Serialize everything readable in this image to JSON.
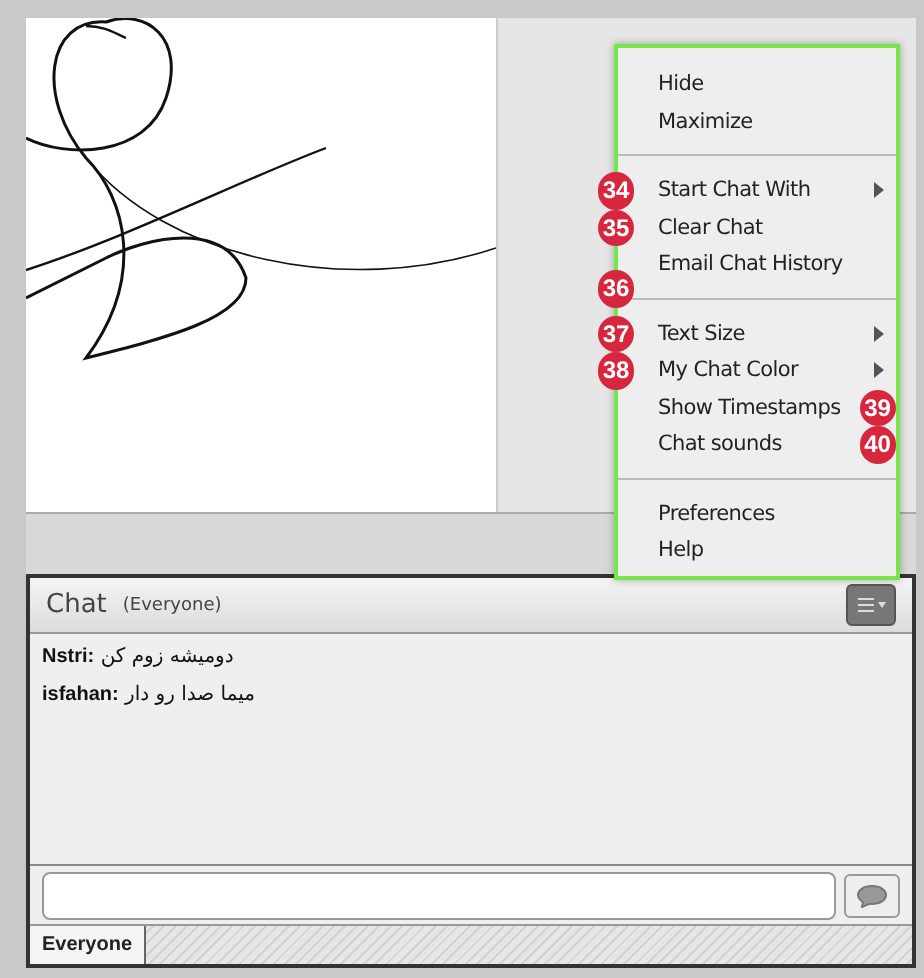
{
  "menu": {
    "sections": [
      {
        "items": [
          {
            "kind": "plain",
            "label": "Hide",
            "submenu": false
          },
          {
            "kind": "plain",
            "label": "Maximize",
            "submenu": false
          }
        ]
      },
      {
        "items": [
          {
            "kind": "badge-left",
            "label": "Start Chat With",
            "submenu": true,
            "badge": "34"
          },
          {
            "kind": "badge-left",
            "label": "Clear Chat",
            "submenu": false,
            "badge": "35"
          },
          {
            "kind": "badge-below",
            "label": "Email Chat History",
            "submenu": false,
            "badge": "36"
          }
        ]
      },
      {
        "items": [
          {
            "kind": "badge-left",
            "label": "Text Size",
            "submenu": true,
            "badge": "37"
          },
          {
            "kind": "badge-left",
            "label": "My Chat Color",
            "submenu": true,
            "badge": "38"
          },
          {
            "kind": "badge-right",
            "label": "Show Timestamps",
            "submenu": false,
            "badge": "39"
          },
          {
            "kind": "badge-right",
            "label": "Chat sounds",
            "submenu": false,
            "badge": "40"
          }
        ]
      },
      {
        "items": [
          {
            "kind": "plain",
            "label": "Preferences",
            "submenu": false
          },
          {
            "kind": "plain",
            "label": "Help",
            "submenu": false
          }
        ]
      }
    ]
  },
  "chat": {
    "title": "Chat",
    "audience": "(Everyone)",
    "messages": [
      {
        "sender": "Nstri:",
        "text": "دومیشه زوم کن"
      },
      {
        "sender": "isfahan:",
        "text": "میما صدا رو دار"
      }
    ],
    "tabs": [
      {
        "label": "Everyone",
        "selected": true
      }
    ]
  }
}
